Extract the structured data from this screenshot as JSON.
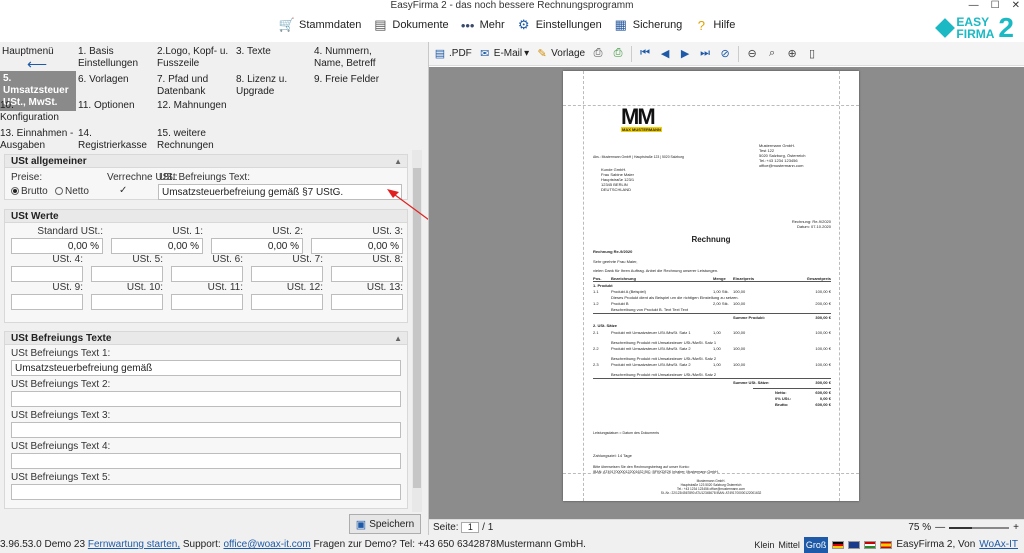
{
  "window": {
    "title": "EasyFirma 2 - das noch bessere Rechnungsprogramm",
    "minimize": "—",
    "maximize": "☐",
    "close": "✕"
  },
  "toolbar": {
    "items": [
      {
        "label": "Stammdaten",
        "icon": "cart-icon",
        "glyph": "🛒"
      },
      {
        "label": "Dokumente",
        "icon": "documents-icon",
        "glyph": "▤"
      },
      {
        "label": "Mehr",
        "icon": "more-icon",
        "glyph": "•••"
      },
      {
        "label": "Einstellungen",
        "icon": "settings-icon",
        "glyph": "⚙"
      },
      {
        "label": "Sicherung",
        "icon": "backup-icon",
        "glyph": "▦"
      },
      {
        "label": "Hilfe",
        "icon": "help-icon",
        "glyph": "?"
      }
    ],
    "logo_line1": "EASY",
    "logo_line2": "FIRMA",
    "logo_num": "2",
    "accent": "#1bb9c4"
  },
  "menu": {
    "home": "Hauptmenü",
    "items": [
      "1. Basis Einstellungen",
      "2.Logo, Kopf- u. Fusszeile",
      "3. Texte",
      "4. Nummern, Name, Betreff",
      "5. Umsatzsteuer USt., MwSt.",
      "6. Vorlagen",
      "7. Pfad und Datenbank",
      "8. Lizenz u. Upgrade",
      "9. Freie Felder",
      "10. Konfiguration",
      "11. Optionen",
      "12. Mahnungen",
      "13. Einnahmen - Ausgaben",
      "14. Registrierkasse",
      "15. weitere Rechnungen"
    ]
  },
  "ust_allgemein": {
    "title": "USt allgemeiner",
    "preise_label": "Preise:",
    "brutto": "Brutto",
    "netto": "Netto",
    "verrechne_label": "Verrechne USt.:",
    "checkmark": "✓",
    "befreiung_label": "USt Befreiungs Text:",
    "befreiung_value": "Umsatzsteuerbefreiung gemäß §7 UStG."
  },
  "ust_werte": {
    "title": "USt Werte",
    "fields": [
      {
        "label": "Standard USt.:",
        "value": "0,00 %"
      },
      {
        "label": "USt. 1:",
        "value": "0,00 %"
      },
      {
        "label": "USt. 2:",
        "value": "0,00 %"
      },
      {
        "label": "USt. 3:",
        "value": "0,00 %"
      },
      {
        "label": "USt. 4:",
        "value": ""
      },
      {
        "label": "USt. 5:",
        "value": ""
      },
      {
        "label": "USt. 6:",
        "value": ""
      },
      {
        "label": "USt. 7:",
        "value": ""
      },
      {
        "label": "USt. 8:",
        "value": ""
      },
      {
        "label": "USt. 9:",
        "value": ""
      },
      {
        "label": "USt. 10:",
        "value": ""
      },
      {
        "label": "USt. 11:",
        "value": ""
      },
      {
        "label": "USt. 12:",
        "value": ""
      },
      {
        "label": "USt. 13:",
        "value": ""
      }
    ]
  },
  "befreiung_texte": {
    "title": "USt Befreiungs Texte",
    "fields": [
      {
        "label": "USt Befreiungs Text 1:",
        "value": "Umsatzsteuerbefreiung gemäß"
      },
      {
        "label": "USt Befreiungs Text 2:",
        "value": ""
      },
      {
        "label": "USt Befreiungs Text 3:",
        "value": ""
      },
      {
        "label": "USt Befreiungs Text 4:",
        "value": ""
      },
      {
        "label": "USt Befreiungs Text 5:",
        "value": ""
      }
    ]
  },
  "save_label": "Speichern",
  "status": {
    "version": "3.96.53.0 Demo 23",
    "remote": "Fernwartung starten,",
    "support_prefix": "Support:",
    "support_email": "office@woax-it.com",
    "question": "Fragen zur Demo? Tel: +43 650 6342878",
    "company": "Mustermann GmbH.",
    "size_small": "Klein",
    "size_medium": "Mittel",
    "size_large": "Groß",
    "copyright": "EasyFirma 2, Von",
    "vendor_link": "WoAx-IT"
  },
  "preview": {
    "pdf": ".PDF",
    "email": "E-Mail",
    "vorlage": "Vorlage",
    "page_label": "Seite:",
    "page_value": "1",
    "page_total": "/ 1",
    "zoom": "75 %",
    "zoom_fraction": 0.75,
    "zoom_minus": "—",
    "zoom_plus": "+"
  },
  "invoice": {
    "logo": "MM",
    "logo_sub": "MAX MUSTERMANN",
    "sender_line": "Abs.: Mustermann GmbH | Hauptstraße 123 | 5020 Salzburg",
    "company_block": [
      "Mustermann GmbH.",
      "Test 122",
      "5020 Salzburg, Österreich",
      "Tel.:+43 1234 123456",
      "office@mustermann.com"
    ],
    "recipient": [
      "Kunde GmbH.",
      "Frau Sabine Maier",
      "Hauptstraße 123/1",
      "12345 BERLIN",
      "DEUTSCHLAND"
    ],
    "meta": [
      "Rechnung: Re-9/2020",
      "Datum: 07.10.2020"
    ],
    "heading": "Rechnung",
    "subject": "Rechnung Re-9/2020",
    "salutation": "Sehr geehrte Frau Maier,",
    "intro": "vielen Dank für Ihren Auftrag. Anbei die Rechnung unserer Leistungen.",
    "table_head": [
      "Pos.",
      "Bezeichnung",
      "Menge",
      "Einzelpreis",
      "Gesamtpreis"
    ],
    "section1": "1. Produkt",
    "rows1": [
      {
        "pos": "1.1",
        "name": "Produkt A (Beispiel)",
        "qty": "1,00 Stk.",
        "price": "100,00",
        "total": "100,00 €"
      },
      {
        "pos": "",
        "name": "Dieses Produkt dient als Beispiel um die richtigen Einstellung zu setzen.",
        "qty": "",
        "price": "",
        "total": ""
      },
      {
        "pos": "1.2",
        "name": "Produkt B",
        "qty": "2,00 Stk.",
        "price": "100,00",
        "total": "200,00 €"
      },
      {
        "pos": "",
        "name": "Beschreibung von Produkt B. Text Text Text",
        "qty": "",
        "price": "",
        "total": ""
      }
    ],
    "sum1_label": "Summe Produkt:",
    "sum1_value": "300,00 €",
    "section2": "2. USt. Sätze",
    "rows2": [
      {
        "pos": "2.1",
        "name": "Produkt mit Umsatzsteuer USt./MwSt. Satz 1",
        "qty": "1,00",
        "price": "100,00",
        "total": "100,00 €",
        "desc": "Beschreibung Produkt mit Umsatzsteuer USt./MwSt. Satz 1"
      },
      {
        "pos": "2.2",
        "name": "Produkt mit Umsatzsteuer USt./MwSt. Satz 2",
        "qty": "1,00",
        "price": "100,00",
        "total": "100,00 €",
        "desc": "Beschreibung Produkt mit Umsatzsteuer USt./MwSt. Satz 2"
      },
      {
        "pos": "2.3",
        "name": "Produkt mit Umsatzsteuer USt./MwSt. Satz 2",
        "qty": "1,00",
        "price": "100,00",
        "total": "100,00 €",
        "desc": "Beschreibung Produkt mit Umsatzsteuer USt./MwSt. Satz 2"
      }
    ],
    "sum2_label": "Summe USt. Sätze:",
    "sum2_value": "300,00 €",
    "netto_label": "Netto:",
    "netto_value": "600,00 €",
    "ust_label": "0% USt.:",
    "ust_value": "0,00 €",
    "brutto_label": "Brutto:",
    "brutto_value": "600,00 €",
    "leistung": "Leistungsdatum = Datum des Dokuments",
    "payment_term": "Zahlungsziel: 14 Tage",
    "payment_text": "Bitte überweisen Sie den Rechnungsbetrag auf unser Konto:",
    "iban": "IBAN: AT491700000122001632   BIC: BFKKDE2K Inhaber: Mustermann GmbH.",
    "footer": [
      "Mustermann GmbH.",
      "Hauptstraße 123 5020 Salzburg Österreich",
      "Tel.: +43 1234 123456 office@mustermann.com",
      "St.-Nr.: 22/123/4567890   ATU12345678   IBAN: AT491700000122001632"
    ]
  }
}
